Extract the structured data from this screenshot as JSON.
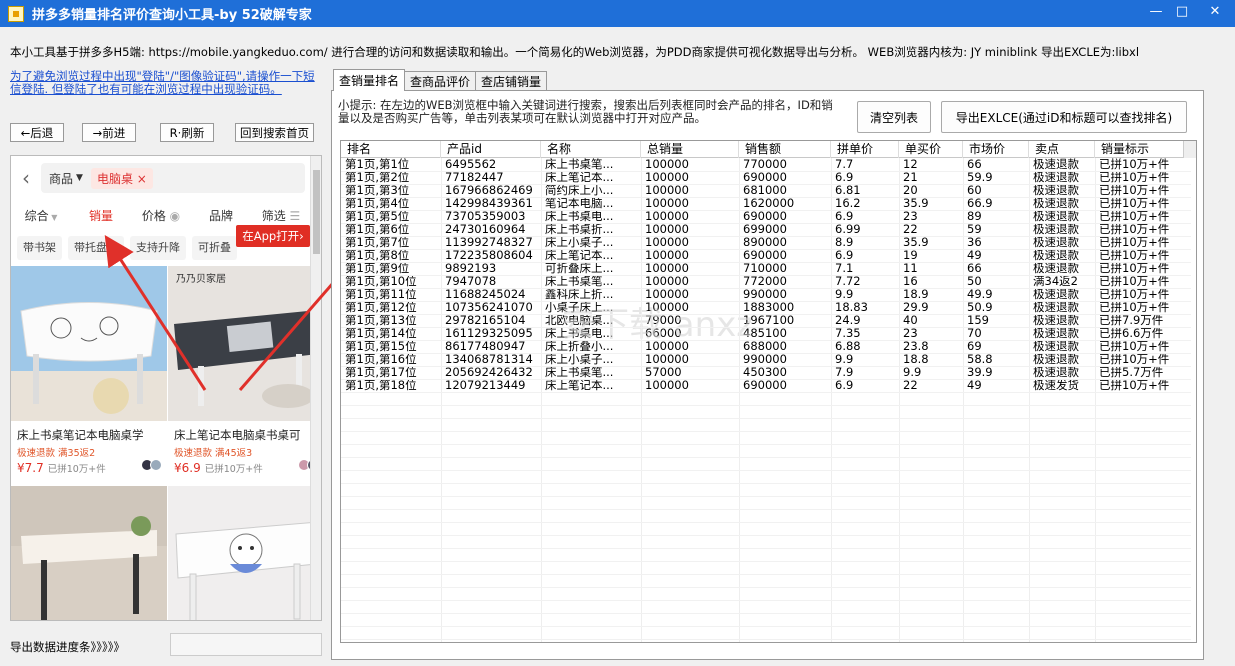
{
  "window": {
    "title": "拼多多销量排名评价查询小工具-by 52破解专家",
    "controls": [
      "—",
      "□",
      "✕"
    ]
  },
  "info_line": "本小工具基于拼多多H5端: https://mobile.yangkeduo.com/ 进行合理的访问和数据读取和输出。一个简易化的Web浏览器，为PDD商家提供可视化数据导出与分析。 WEB浏览器内核为: JY miniblink 导出EXCLE为:libxl",
  "left": {
    "warning": "为了避免浏览过程中出现\"登陆\"/\"图像验证码\",请操作一下短信登陆. 但登陆了也有可能在浏览过程中出现验证码。",
    "nav": {
      "back": "←后退",
      "forward": "→前进",
      "refresh": "R·刷新",
      "home": "回到搜索首页"
    },
    "browser": {
      "category": "商品",
      "keyword": "电脑桌",
      "filters": [
        "综合",
        "销量",
        "价格",
        "品牌",
        "筛选"
      ],
      "active_filter": "销量",
      "tags": [
        "带书架",
        "带托盘架",
        "支持升降",
        "可折叠"
      ],
      "app_open": "在App打开",
      "products": [
        {
          "title": "床上书桌笔记本电脑桌学",
          "badges": "极速退款  满35返2",
          "price": "¥7.7",
          "sold": "已拼10万+件"
        },
        {
          "title": "床上笔记本电脑桌书桌可",
          "badges": "极速退款  满45返3",
          "price": "¥6.9",
          "sold": "已拼10万+件"
        },
        {
          "title": "",
          "badges": "",
          "price": "",
          "sold": ""
        },
        {
          "title": "",
          "badges": "",
          "price": "",
          "sold": ""
        }
      ],
      "brand_mark": "乃乃贝家居"
    },
    "progress_label": "导出数据进度条》》》》》",
    "progress": 0
  },
  "right": {
    "tabs": [
      "查销量排名",
      "查商品评价",
      "查店铺销量"
    ],
    "active_tab": 0,
    "hint": "小提示: 在左边的WEB浏览框中输入关键词进行搜索，搜索出后列表框同时会产品的排名，ID和销量以及是否购买广告等，单击列表某项可在默认浏览器中打开对应产品。",
    "clear_button": "清空列表",
    "export_button": "导出EXLCE(通过iD和标题可以查找排名)",
    "table": {
      "columns": [
        "排名",
        "产品id",
        "名称",
        "总销量",
        "销售额",
        "拼单价",
        "单买价",
        "市场价",
        "卖点",
        "销量标示"
      ],
      "rows": [
        [
          "第1页,第1位",
          "6495562",
          "床上书桌笔...",
          "100000",
          "770000",
          "7.7",
          "12",
          "66",
          "极速退款",
          "已拼10万+件"
        ],
        [
          "第1页,第2位",
          "77182447",
          "床上笔记本...",
          "100000",
          "690000",
          "6.9",
          "21",
          "59.9",
          "极速退款",
          "已拼10万+件"
        ],
        [
          "第1页,第3位",
          "167966862469",
          "简约床上小...",
          "100000",
          "681000",
          "6.81",
          "20",
          "60",
          "极速退款",
          "已拼10万+件"
        ],
        [
          "第1页,第4位",
          "142998439361",
          "笔记本电脑...",
          "100000",
          "1620000",
          "16.2",
          "35.9",
          "66.9",
          "极速退款",
          "已拼10万+件"
        ],
        [
          "第1页,第5位",
          "73705359003",
          "床上书桌电...",
          "100000",
          "690000",
          "6.9",
          "23",
          "89",
          "极速退款",
          "已拼10万+件"
        ],
        [
          "第1页,第6位",
          "24730160964",
          "床上书桌折...",
          "100000",
          "699000",
          "6.99",
          "22",
          "59",
          "极速退款",
          "已拼10万+件"
        ],
        [
          "第1页,第7位",
          "113992748327",
          "床上小桌子...",
          "100000",
          "890000",
          "8.9",
          "35.9",
          "36",
          "极速退款",
          "已拼10万+件"
        ],
        [
          "第1页,第8位",
          "172235808604",
          "床上笔记本...",
          "100000",
          "690000",
          "6.9",
          "19",
          "49",
          "极速退款",
          "已拼10万+件"
        ],
        [
          "第1页,第9位",
          "9892193",
          "可折叠床上...",
          "100000",
          "710000",
          "7.1",
          "11",
          "66",
          "极速退款",
          "已拼10万+件"
        ],
        [
          "第1页,第10位",
          "7947078",
          "床上书桌笔...",
          "100000",
          "772000",
          "7.72",
          "16",
          "50",
          "满34返2",
          "已拼10万+件"
        ],
        [
          "第1页,第11位",
          "11688245024",
          "鑫科床上折...",
          "100000",
          "990000",
          "9.9",
          "18.9",
          "49.9",
          "极速退款",
          "已拼10万+件"
        ],
        [
          "第1页,第12位",
          "107356241070",
          "小桌子床上...",
          "100000",
          "1883000",
          "18.83",
          "29.9",
          "50.9",
          "极速退款",
          "已拼10万+件"
        ],
        [
          "第1页,第13位",
          "29782165104",
          "北欧电脑桌...",
          "79000",
          "1967100",
          "24.9",
          "40",
          "159",
          "极速退款",
          "已拼7.9万件"
        ],
        [
          "第1页,第14位",
          "161129325095",
          "床上书桌电...",
          "66000",
          "485100",
          "7.35",
          "23",
          "70",
          "极速退款",
          "已拼6.6万件"
        ],
        [
          "第1页,第15位",
          "86177480947",
          "床上折叠小...",
          "100000",
          "688000",
          "6.88",
          "23.8",
          "69",
          "极速退款",
          "已拼10万+件"
        ],
        [
          "第1页,第16位",
          "134068781314",
          "床上小桌子...",
          "100000",
          "990000",
          "9.9",
          "18.8",
          "58.8",
          "极速退款",
          "已拼10万+件"
        ],
        [
          "第1页,第17位",
          "205692426432",
          "床上书桌笔...",
          "57000",
          "450300",
          "7.9",
          "9.9",
          "39.9",
          "极速退款",
          "已拼5.7万件"
        ],
        [
          "第1页,第18位",
          "12079213449",
          "床上笔记本...",
          "100000",
          "690000",
          "6.9",
          "22",
          "49",
          "极速发货",
          "已拼10万+件"
        ]
      ]
    }
  },
  "watermark": "安下载 anxz.com",
  "colors": {
    "titlebar": "#1f6fd8",
    "accent_red": "#e02e24",
    "link_blue": "#1a4fd0"
  }
}
